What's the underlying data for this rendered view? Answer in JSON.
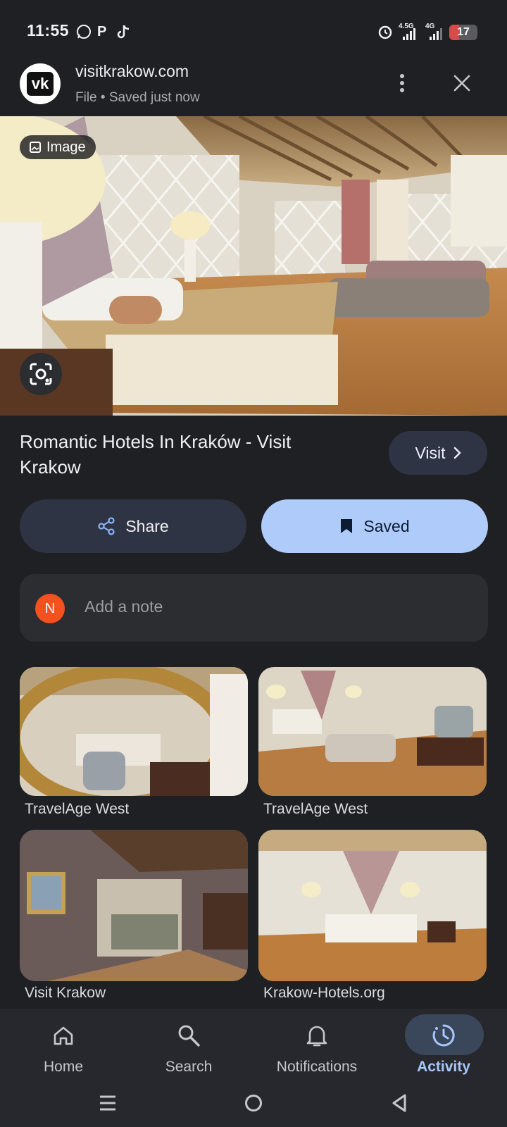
{
  "status_bar": {
    "time": "11:55",
    "net1": "4.5G",
    "net2": "4G",
    "battery": "17"
  },
  "header": {
    "avatar_text": "vk",
    "site": "visitkrakow.com",
    "subtitle": "File • Saved just now"
  },
  "hero": {
    "chip_label": "Image"
  },
  "result": {
    "title": "Romantic Hotels In Kraków - Visit Krakow",
    "visit_label": "Visit"
  },
  "actions": {
    "share_label": "Share",
    "saved_label": "Saved"
  },
  "note": {
    "avatar_letter": "N",
    "placeholder": "Add a note"
  },
  "related": [
    {
      "source": "TravelAge West"
    },
    {
      "source": "TravelAge West"
    },
    {
      "source": "Visit Krakow"
    },
    {
      "source": "Krakow-Hotels.org"
    }
  ],
  "bottom_nav": [
    {
      "label": "Home",
      "icon": "home-icon"
    },
    {
      "label": "Search",
      "icon": "search-icon"
    },
    {
      "label": "Notifications",
      "icon": "bell-icon"
    },
    {
      "label": "Activity",
      "icon": "activity-icon",
      "active": true
    }
  ],
  "colors": {
    "background": "#1f2024",
    "saved_button": "#aecbfa",
    "active_nav": "#a8c7fa",
    "note_avatar": "#f4511e"
  }
}
